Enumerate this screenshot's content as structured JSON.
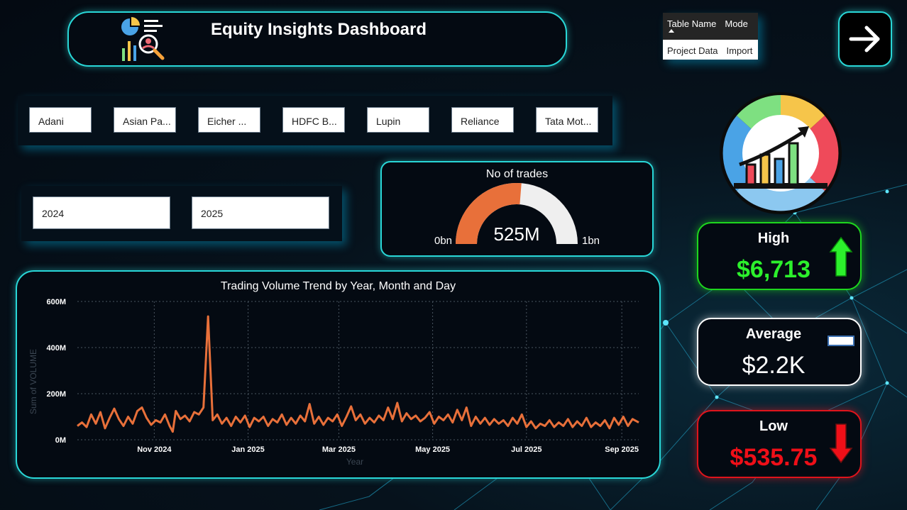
{
  "header": {
    "title": "Equity Insights Dashboard"
  },
  "table_card": {
    "columns": [
      "Table Name",
      "Mode"
    ],
    "rows": [
      [
        "Project Data",
        "Import"
      ]
    ]
  },
  "stocks": {
    "items": [
      "Adani",
      "Asian Pa...",
      "Eicher ...",
      "HDFC B...",
      "Lupin",
      "Reliance",
      "Tata Mot..."
    ]
  },
  "years": {
    "items": [
      "2024",
      "2025"
    ]
  },
  "gauge": {
    "title": "No of trades",
    "value_label": "525M",
    "min_label": "0bn",
    "max_label": "1bn",
    "fraction": 0.525,
    "fill_color": "#e8703a",
    "track_color": "#efefef"
  },
  "kpis": {
    "high": {
      "label": "High",
      "value": "$6,713",
      "icon": "up-arrow-icon",
      "color": "#2cf02c"
    },
    "average": {
      "label": "Average",
      "value": "$2.2K",
      "icon": "flat-dash-icon",
      "color": "#ffffff"
    },
    "low": {
      "label": "Low",
      "value": "$535.75",
      "icon": "down-arrow-icon",
      "color": "#ef0f18"
    }
  },
  "colors": {
    "accent": "#29d7d7",
    "line": "#e8703a",
    "background": "#040a12"
  },
  "chart_data": {
    "type": "line",
    "title": "Trading Volume Trend by Year, Month and Day",
    "xlabel": "Year",
    "ylabel": "Sum of VOLUME",
    "ylim": [
      0,
      600
    ],
    "y_unit": "M",
    "yticks": [
      "0M",
      "200M",
      "400M",
      "600M"
    ],
    "xticks": [
      "Nov 2024",
      "Jan 2025",
      "Mar 2025",
      "May 2025",
      "Jul 2025",
      "Sep 2025"
    ],
    "xrange": [
      "2024-09-12",
      "2025-09-12"
    ],
    "grid": true,
    "series": [
      {
        "color": "#e8703a",
        "points": [
          [
            "2024-09-12",
            60
          ],
          [
            "2024-09-15",
            75
          ],
          [
            "2024-09-18",
            55
          ],
          [
            "2024-09-21",
            110
          ],
          [
            "2024-09-24",
            70
          ],
          [
            "2024-09-27",
            120
          ],
          [
            "2024-09-30",
            50
          ],
          [
            "2024-10-03",
            95
          ],
          [
            "2024-10-06",
            135
          ],
          [
            "2024-10-09",
            90
          ],
          [
            "2024-10-12",
            60
          ],
          [
            "2024-10-15",
            100
          ],
          [
            "2024-10-18",
            70
          ],
          [
            "2024-10-21",
            125
          ],
          [
            "2024-10-24",
            140
          ],
          [
            "2024-10-27",
            95
          ],
          [
            "2024-10-30",
            65
          ],
          [
            "2024-11-02",
            85
          ],
          [
            "2024-11-05",
            75
          ],
          [
            "2024-11-08",
            110
          ],
          [
            "2024-11-11",
            60
          ],
          [
            "2024-11-13",
            35
          ],
          [
            "2024-11-15",
            125
          ],
          [
            "2024-11-18",
            90
          ],
          [
            "2024-11-21",
            105
          ],
          [
            "2024-11-24",
            80
          ],
          [
            "2024-11-27",
            120
          ],
          [
            "2024-11-30",
            110
          ],
          [
            "2024-12-03",
            140
          ],
          [
            "2024-12-06",
            535
          ],
          [
            "2024-12-09",
            85
          ],
          [
            "2024-12-12",
            110
          ],
          [
            "2024-12-15",
            70
          ],
          [
            "2024-12-18",
            95
          ],
          [
            "2024-12-21",
            60
          ],
          [
            "2024-12-24",
            100
          ],
          [
            "2024-12-27",
            75
          ],
          [
            "2024-12-30",
            105
          ],
          [
            "2025-01-02",
            55
          ],
          [
            "2025-01-05",
            95
          ],
          [
            "2025-01-08",
            80
          ],
          [
            "2025-01-11",
            100
          ],
          [
            "2025-01-14",
            60
          ],
          [
            "2025-01-17",
            90
          ],
          [
            "2025-01-20",
            75
          ],
          [
            "2025-01-23",
            110
          ],
          [
            "2025-01-26",
            65
          ],
          [
            "2025-01-29",
            95
          ],
          [
            "2025-02-01",
            70
          ],
          [
            "2025-02-04",
            105
          ],
          [
            "2025-02-07",
            80
          ],
          [
            "2025-02-10",
            155
          ],
          [
            "2025-02-13",
            70
          ],
          [
            "2025-02-16",
            100
          ],
          [
            "2025-02-19",
            65
          ],
          [
            "2025-02-22",
            95
          ],
          [
            "2025-02-25",
            80
          ],
          [
            "2025-02-28",
            110
          ],
          [
            "2025-03-03",
            60
          ],
          [
            "2025-03-06",
            100
          ],
          [
            "2025-03-09",
            145
          ],
          [
            "2025-03-12",
            85
          ],
          [
            "2025-03-15",
            110
          ],
          [
            "2025-03-18",
            70
          ],
          [
            "2025-03-21",
            95
          ],
          [
            "2025-03-24",
            75
          ],
          [
            "2025-03-27",
            105
          ],
          [
            "2025-03-30",
            85
          ],
          [
            "2025-04-02",
            140
          ],
          [
            "2025-04-05",
            90
          ],
          [
            "2025-04-08",
            160
          ],
          [
            "2025-04-11",
            80
          ],
          [
            "2025-04-14",
            115
          ],
          [
            "2025-04-17",
            90
          ],
          [
            "2025-04-20",
            105
          ],
          [
            "2025-04-23",
            80
          ],
          [
            "2025-04-26",
            95
          ],
          [
            "2025-04-29",
            120
          ],
          [
            "2025-05-02",
            70
          ],
          [
            "2025-05-05",
            100
          ],
          [
            "2025-05-08",
            85
          ],
          [
            "2025-05-11",
            110
          ],
          [
            "2025-05-14",
            75
          ],
          [
            "2025-05-17",
            130
          ],
          [
            "2025-05-20",
            85
          ],
          [
            "2025-05-23",
            140
          ],
          [
            "2025-05-26",
            60
          ],
          [
            "2025-05-29",
            100
          ],
          [
            "2025-06-01",
            70
          ],
          [
            "2025-06-04",
            95
          ],
          [
            "2025-06-07",
            65
          ],
          [
            "2025-06-10",
            90
          ],
          [
            "2025-06-13",
            70
          ],
          [
            "2025-06-16",
            85
          ],
          [
            "2025-06-19",
            60
          ],
          [
            "2025-06-22",
            95
          ],
          [
            "2025-06-25",
            70
          ],
          [
            "2025-06-28",
            110
          ],
          [
            "2025-07-01",
            55
          ],
          [
            "2025-07-04",
            80
          ],
          [
            "2025-07-07",
            50
          ],
          [
            "2025-07-10",
            70
          ],
          [
            "2025-07-13",
            60
          ],
          [
            "2025-07-16",
            85
          ],
          [
            "2025-07-19",
            55
          ],
          [
            "2025-07-22",
            75
          ],
          [
            "2025-07-25",
            60
          ],
          [
            "2025-07-28",
            90
          ],
          [
            "2025-07-31",
            55
          ],
          [
            "2025-08-03",
            80
          ],
          [
            "2025-08-06",
            60
          ],
          [
            "2025-08-09",
            95
          ],
          [
            "2025-08-12",
            55
          ],
          [
            "2025-08-15",
            75
          ],
          [
            "2025-08-18",
            60
          ],
          [
            "2025-08-21",
            85
          ],
          [
            "2025-08-24",
            50
          ],
          [
            "2025-08-27",
            95
          ],
          [
            "2025-08-30",
            65
          ],
          [
            "2025-09-02",
            100
          ],
          [
            "2025-09-05",
            60
          ],
          [
            "2025-09-08",
            90
          ],
          [
            "2025-09-12",
            75
          ]
        ]
      }
    ]
  }
}
